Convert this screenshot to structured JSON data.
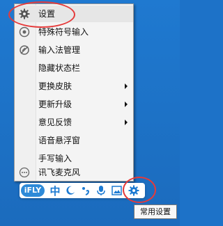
{
  "menu": {
    "items": [
      {
        "label": "设置",
        "icon": "gear-icon",
        "submenu": false
      },
      {
        "label": "特殊符号输入",
        "icon": "special-symbol-icon",
        "submenu": false
      },
      {
        "label": "输入法管理",
        "icon": "manage-icon",
        "submenu": false
      },
      {
        "label": "隐藏状态栏",
        "icon": "",
        "submenu": false
      },
      {
        "label": "更换皮肤",
        "icon": "",
        "submenu": true
      },
      {
        "label": "更新升级",
        "icon": "",
        "submenu": true
      },
      {
        "label": "意见反馈",
        "icon": "",
        "submenu": true
      },
      {
        "label": "语音悬浮窗",
        "icon": "",
        "submenu": false
      },
      {
        "label": "手写输入",
        "icon": "",
        "submenu": false
      },
      {
        "label": "讯飞麦克风",
        "icon": "more-icon",
        "submenu": false
      }
    ]
  },
  "toolbar": {
    "logo_text": "iFLY",
    "mode_label": "中",
    "icons": [
      "half-width-moon-icon",
      "punctuation-icon",
      "microphone-icon",
      "image-icon",
      "settings-gear-icon"
    ]
  },
  "tooltip": {
    "text": "常用设置"
  },
  "colors": {
    "desktop": "#1d72c8",
    "accent": "#1c7ad2",
    "highlight_circle": "#e53a3a"
  }
}
